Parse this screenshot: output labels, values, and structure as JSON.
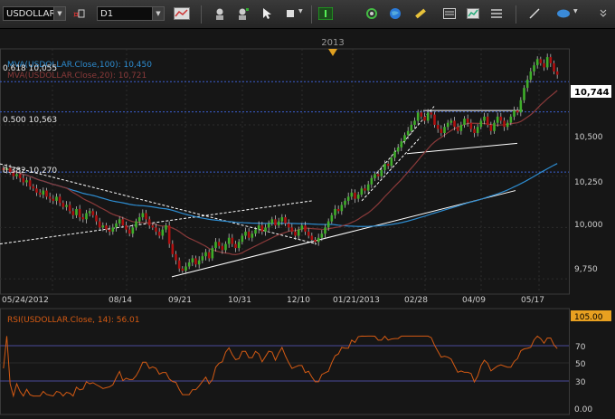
{
  "toolbar": {
    "symbol": "USDOLLAR",
    "timeframe": "D1",
    "icons": [
      "currency-pair-icon",
      "chart-type-icon",
      "crosshair-icon",
      "zoom-icon",
      "cursor-icon",
      "square-icon",
      "draw-line-icon",
      "refresh-icon",
      "globe-icon",
      "ruler-icon",
      "template-icon",
      "list-icon",
      "trend-line-icon",
      "ellipse-icon"
    ]
  },
  "colors": {
    "background": "#161616",
    "grid": "#2c2c2c",
    "candle_up": "#3fae2a",
    "candle_down": "#b01010",
    "ma100": "#2d8cd0",
    "ma20": "#8a3a3a",
    "fib_line": "#3b5fd0",
    "rsi_line": "#d45a13",
    "rsi_label": "#d45a13",
    "trendline": "#ffffff"
  },
  "main_chart": {
    "year_label": "2013",
    "indicator_ma100": "MVA(USDOLLAR.Close,100): 10,450",
    "indicator_ma20": "MVA(USDOLLAR.Close,20): 10,721",
    "fib_levels": [
      {
        "label": "0.618 10,055",
        "price": 10710
      },
      {
        "label": "0.500 10,563",
        "price": 10563
      },
      {
        "label": "0.382 10,270",
        "price": 10270
      }
    ],
    "price_labels": [
      "10,500",
      "10,250",
      "10,000",
      "9,750"
    ],
    "current_price": "10,744",
    "date_labels": [
      "05/24/2012",
      "08/14",
      "09/21",
      "10/31",
      "12/10",
      "01/21/2013",
      "02/28",
      "04/09",
      "05/17"
    ]
  },
  "rsi_panel": {
    "title": "RSI(USDOLLAR.Close, 14): 56.01",
    "levels": [
      "105.00",
      "70",
      "50",
      "30",
      "0.00"
    ]
  },
  "chart_data": [
    {
      "type": "line",
      "title": "USDOLLAR D1",
      "series": [
        {
          "name": "MVA(USDOLLAR.Close,100)",
          "value_last": 10450
        },
        {
          "name": "MVA(USDOLLAR.Close,20)",
          "value_last": 10721
        }
      ],
      "y_ticks": [
        9750,
        10000,
        10250,
        10500
      ],
      "ylim": [
        9680,
        10870
      ],
      "x_labels": [
        "05/24/2012",
        "08/14",
        "09/21",
        "10/31",
        "12/10",
        "01/21/2013",
        "02/28",
        "04/09",
        "05/17"
      ],
      "closes": [
        10280,
        10290,
        10270,
        10250,
        10260,
        10240,
        10220,
        10230,
        10200,
        10190,
        10170,
        10160,
        10180,
        10150,
        10140,
        10130,
        10150,
        10120,
        10100,
        10110,
        10080,
        10060,
        10090,
        10050,
        10040,
        10070,
        10080,
        10060,
        10030,
        10000,
        10010,
        9990,
        9980,
        10000,
        10020,
        10040,
        10010,
        9990,
        9970,
        10000,
        10030,
        10050,
        10070,
        10040,
        10010,
        10000,
        9980,
        9960,
        9990,
        10010,
        9920,
        9870,
        9840,
        9800,
        9790,
        9810,
        9830,
        9850,
        9820,
        9840,
        9860,
        9880,
        9850,
        9900,
        9930,
        9910,
        9890,
        9920,
        9950,
        9920,
        9900,
        9930,
        9960,
        9980,
        9950,
        9970,
        9990,
        10010,
        9980,
        10000,
        10020,
        10040,
        10010,
        10030,
        10050,
        10020,
        10000,
        9980,
        9960,
        9990,
        10010,
        9980,
        9960,
        9940,
        9930,
        9950,
        9970,
        10000,
        10030,
        10060,
        10090,
        10080,
        10110,
        10130,
        10150,
        10170,
        10140,
        10160,
        10190,
        10180,
        10210,
        10240,
        10260,
        10250,
        10280,
        10310,
        10300,
        10340,
        10370,
        10390,
        10420,
        10450,
        10470,
        10500,
        10520,
        10560,
        10540,
        10520,
        10560,
        10550,
        10500,
        10480,
        10460,
        10490,
        10510,
        10520,
        10490,
        10470,
        10500,
        10530,
        10510,
        10480,
        10460,
        10490,
        10520,
        10540,
        10500,
        10470,
        10510,
        10540,
        10520,
        10490,
        10510,
        10540,
        10570,
        10560,
        10620,
        10680,
        10720,
        10760,
        10790,
        10820,
        10800,
        10780,
        10830,
        10800,
        10760,
        10744
      ]
    },
    {
      "type": "line",
      "title": "RSI(USDOLLAR.Close, 14): 56.01",
      "series": [
        {
          "name": "RSI(USDOLLAR.Close, 14)",
          "value_last": 56.01
        }
      ],
      "levels": [
        30,
        50,
        70
      ],
      "ylim": [
        0,
        105
      ]
    }
  ]
}
